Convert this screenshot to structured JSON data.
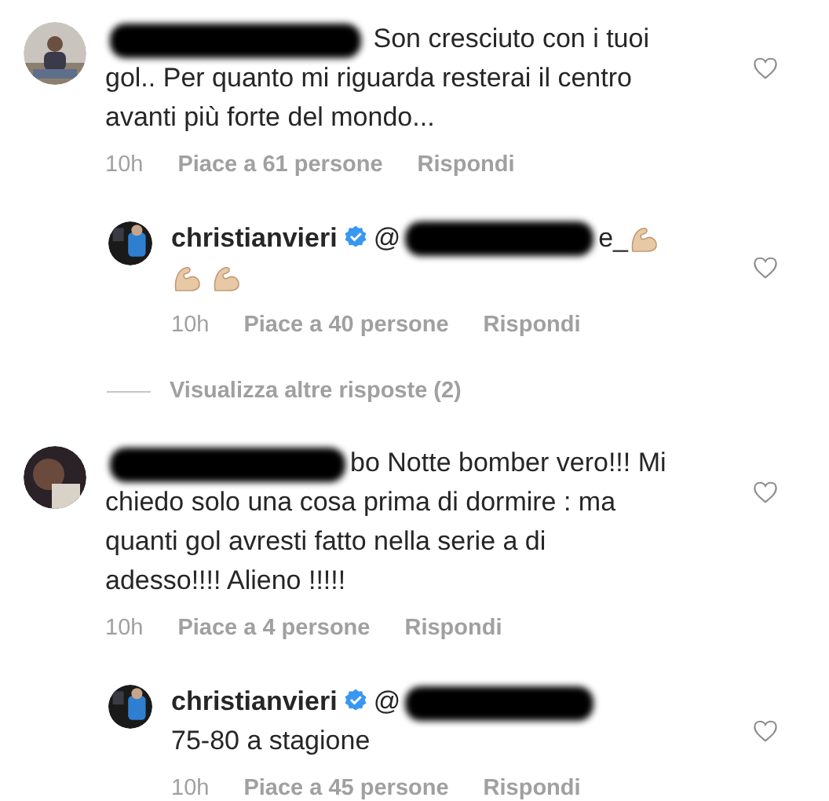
{
  "comments": [
    {
      "kind": "comment",
      "lines": [
        "Son cresciuto con i tuoi",
        "gol.. Per quanto mi riguarda resterai il centro",
        "avanti più forte del mondo..."
      ],
      "time": "10h",
      "likes": "Piace a 61 persone",
      "reply": "Rispondi"
    },
    {
      "kind": "reply",
      "username": "christianvieri",
      "verified": true,
      "mention_prefix": "@",
      "mention_suffix": "e_",
      "emojis": [
        {
          "kind": "flexed-biceps"
        },
        {
          "kind": "flexed-biceps"
        },
        {
          "kind": "flexed-biceps"
        }
      ],
      "time": "10h",
      "likes": "Piace a 40 persone",
      "reply": "Rispondi"
    },
    {
      "kind": "more",
      "label": "Visualizza altre risposte (2)"
    },
    {
      "kind": "comment",
      "mention_suffix": "bo",
      "lines": [
        "Notte bomber vero!!! Mi",
        "chiedo solo una cosa prima di dormire : ma",
        "quanti gol avresti fatto nella serie a di",
        "adesso!!!! Alieno !!!!!"
      ],
      "time": "10h",
      "likes": "Piace a 4 persone",
      "reply": "Rispondi"
    },
    {
      "kind": "reply",
      "username": "christianvieri",
      "verified": true,
      "mention_prefix": "@",
      "lines": [
        "75-80 a stagione"
      ],
      "time": "10h",
      "likes": "Piace a 45 persone",
      "reply": "Rispondi"
    }
  ]
}
